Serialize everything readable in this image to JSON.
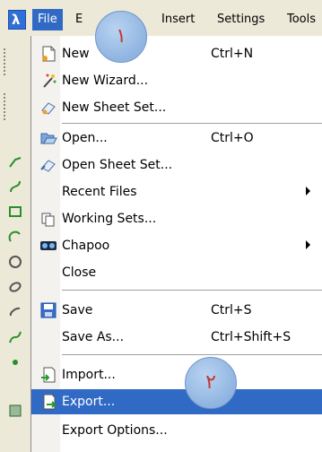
{
  "menubar": {
    "items": [
      {
        "label": "File"
      },
      {
        "label": "E"
      },
      {
        "label": "Insert"
      },
      {
        "label": "Settings"
      },
      {
        "label": "Tools"
      }
    ]
  },
  "file_menu": {
    "items": [
      {
        "label": "New",
        "shortcut": "Ctrl+N",
        "icon": "new-document-icon"
      },
      {
        "label": "New Wizard...",
        "shortcut": "",
        "icon": "wizard-wand-icon"
      },
      {
        "label": "New Sheet Set...",
        "shortcut": "",
        "icon": "sheet-set-new-icon"
      },
      {
        "label": "Open...",
        "shortcut": "Ctrl+O",
        "icon": "open-folder-icon"
      },
      {
        "label": "Open Sheet Set...",
        "shortcut": "",
        "icon": "sheet-set-open-icon"
      },
      {
        "label": "Recent Files",
        "shortcut": "",
        "submenu": true
      },
      {
        "label": "Working Sets...",
        "shortcut": "",
        "icon": "working-sets-icon"
      },
      {
        "label": "Chapoo",
        "shortcut": "",
        "icon": "chapoo-icon",
        "submenu": true
      },
      {
        "label": "Close",
        "shortcut": ""
      },
      {
        "label": "Save",
        "shortcut": "Ctrl+S",
        "icon": "save-disk-icon"
      },
      {
        "label": "Save As...",
        "shortcut": "Ctrl+Shift+S"
      },
      {
        "label": "Import...",
        "shortcut": "",
        "icon": "import-icon"
      },
      {
        "label": "Export...",
        "shortcut": "",
        "icon": "export-icon",
        "selected": true
      },
      {
        "label": "Export Options...",
        "shortcut": ""
      }
    ]
  },
  "callouts": {
    "one": "١",
    "two": "٢"
  },
  "colors": {
    "highlight": "#316ac5",
    "callout": "#8fb4e0",
    "callout_text": "#c0392b"
  }
}
